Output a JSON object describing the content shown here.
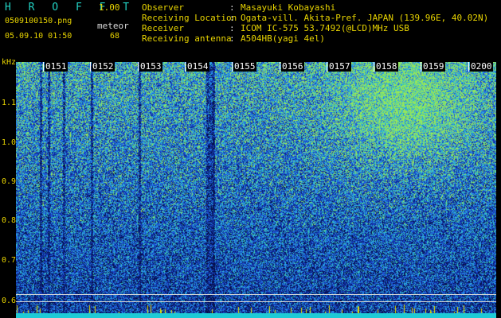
{
  "header": {
    "app_title": "H R O F F T",
    "app_version": "1.00",
    "filename": "0509100150.png",
    "meteor_label": "meteor",
    "datetime": "05.09.10 01:50",
    "meteor_count": "68"
  },
  "metadata": [
    {
      "label": "Observer",
      "value": "Masayuki Kobayashi"
    },
    {
      "label": "Receiving Location",
      "value": "Ogata-vill. Akita-Pref. JAPAN (139.96E, 40.02N)"
    },
    {
      "label": "Receiver",
      "value": "ICOM IC-575 53.7492(@LCD)MHz USB"
    },
    {
      "label": "Receiving antenna",
      "value": "A504HB(yagi 4el)"
    }
  ],
  "yaxis": {
    "unit": "kHz",
    "ticks": [
      "1.1",
      "1.0",
      "0.9",
      "0.8",
      "0.7",
      "0.6"
    ]
  },
  "time_labels": [
    "0151",
    "0152",
    "0153",
    "0154",
    "0155",
    "0156",
    "0157",
    "0158",
    "0159",
    "0200"
  ],
  "colors": {
    "text_yellow": "#e8d400",
    "title_cyan": "#22d3c5",
    "spectrogram_background": "#0a1a60",
    "baseline": "#1ecbd6"
  }
}
